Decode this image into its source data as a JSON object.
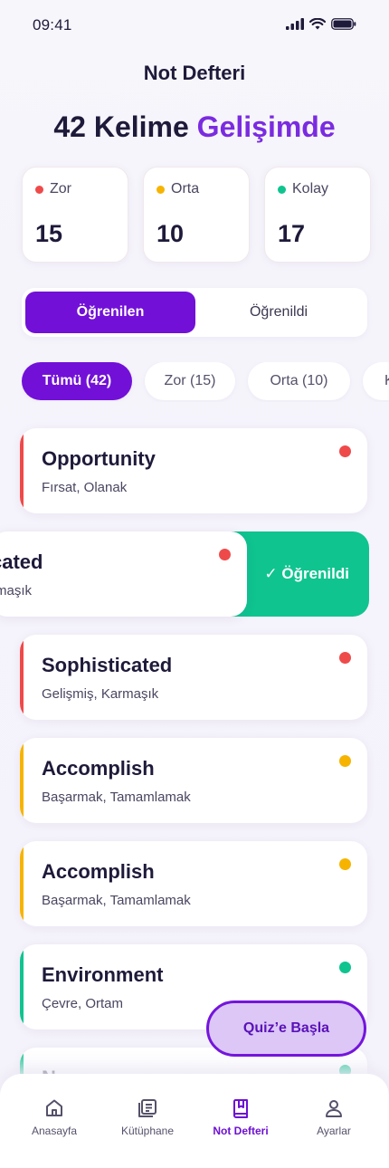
{
  "status": {
    "time": "09:41"
  },
  "header": {
    "title": "Not Defteri"
  },
  "headline": {
    "count_text": "42 Kelime",
    "accent_text": "Gelişimde"
  },
  "stats": [
    {
      "label": "Zor",
      "value": "15",
      "color": "#ef4a4a"
    },
    {
      "label": "Orta",
      "value": "10",
      "color": "#f6b400"
    },
    {
      "label": "Kolay",
      "value": "17",
      "color": "#0fc48f"
    }
  ],
  "segments": {
    "learning": "Öğrenilen",
    "learned": "Öğrenildi"
  },
  "chips": [
    "Tümü (42)",
    "Zor (15)",
    "Orta (10)",
    "K"
  ],
  "words": [
    {
      "title": "Opportunity",
      "meaning": "Fırsat, Olanak",
      "color": "#ef4a4a"
    },
    {
      "title": "cated",
      "meaning": "rmaşık",
      "color": "#ef4a4a"
    },
    {
      "title": "Sophisticated",
      "meaning": "Gelişmiş, Karmaşık",
      "color": "#ef4a4a"
    },
    {
      "title": "Accomplish",
      "meaning": "Başarmak, Tamamlamak",
      "color": "#f6b400"
    },
    {
      "title": "Accomplish",
      "meaning": "Başarmak, Tamamlamak",
      "color": "#f6b400"
    },
    {
      "title": "Environment",
      "meaning": "Çevre, Ortam",
      "color": "#0fc48f"
    },
    {
      "title": "N",
      "meaning": "",
      "color": "#0fc48f"
    }
  ],
  "swipe_action": {
    "label": "✓ Öğrenildi"
  },
  "quiz_button": {
    "label": "Quiz’e Başla"
  },
  "nav": [
    {
      "label": "Anasayfa",
      "icon": "home-icon"
    },
    {
      "label": "Kütüphane",
      "icon": "library-icon"
    },
    {
      "label": "Not Defteri",
      "icon": "notebook-icon"
    },
    {
      "label": "Ayarlar",
      "icon": "user-icon"
    }
  ]
}
